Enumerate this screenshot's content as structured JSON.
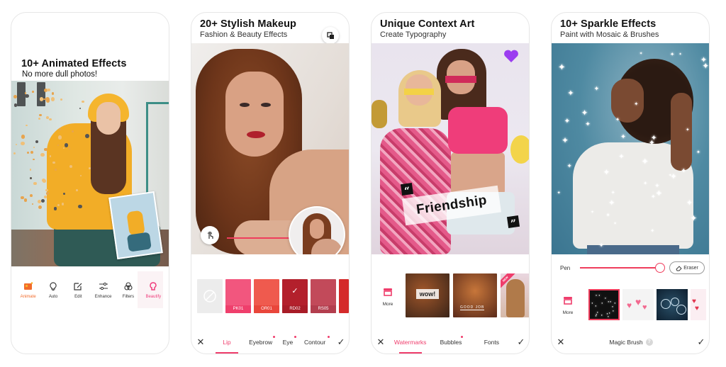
{
  "cards": [
    {
      "title": "10+ Animated Effects",
      "subtitle": "No more dull photos!",
      "toolbar": [
        {
          "icon": "animate-icon",
          "label": "Animate",
          "state": "active"
        },
        {
          "icon": "auto-icon",
          "label": "Auto"
        },
        {
          "icon": "edit-icon",
          "label": "Edit"
        },
        {
          "icon": "enhance-icon",
          "label": "Enhance"
        },
        {
          "icon": "filters-icon",
          "label": "Filters"
        },
        {
          "icon": "beautify-icon",
          "label": "Beautify",
          "state": "highlighted"
        }
      ]
    },
    {
      "title": "20+ Stylish Makeup",
      "subtitle": "Fashion & Beauty Effects",
      "swatches": [
        {
          "label": "",
          "type": "none"
        },
        {
          "label": "PK01",
          "color": "#f2567e"
        },
        {
          "label": "OR01",
          "color": "#ef5a4e"
        },
        {
          "label": "RD02",
          "color": "#b3202c",
          "selected": true,
          "check": "✓"
        },
        {
          "label": "RS05",
          "color": "#c24a5a"
        }
      ],
      "tabs": [
        {
          "label": "Lip",
          "active": true,
          "dot": false
        },
        {
          "label": "Eyebrow",
          "dot": true
        },
        {
          "label": "Eye",
          "dot": true
        },
        {
          "label": "Contour",
          "dot": true
        }
      ],
      "close": "✕",
      "confirm": "✓"
    },
    {
      "title": "Unique Context Art",
      "subtitle": "Create Typography",
      "overlay_text": "Friendship",
      "quote_open": "“",
      "quote_close": "”",
      "more_label": "More",
      "thumbs": [
        {
          "tag": "wow!"
        },
        {
          "tag": "GOOD JOB"
        },
        {
          "badge": "NEW"
        }
      ],
      "tabs": [
        {
          "label": "Watermarks",
          "active": true,
          "dot": false
        },
        {
          "label": "Bubbles",
          "dot": true
        },
        {
          "label": "Fonts",
          "dot": false
        }
      ],
      "close": "✕",
      "confirm": "✓"
    },
    {
      "title": "10+ Sparkle Effects",
      "subtitle": "Paint with Mosaic & Brushes",
      "pen_label": "Pen",
      "pen_size_fraction": 1.0,
      "eraser_label": "Eraser",
      "more_label": "More",
      "brushes": [
        "sparkles",
        "pink-hearts",
        "bubbles",
        "red-hearts"
      ],
      "bottom_title": "Magic Brush",
      "help": "?",
      "close": "✕",
      "confirm": "✓"
    }
  ]
}
